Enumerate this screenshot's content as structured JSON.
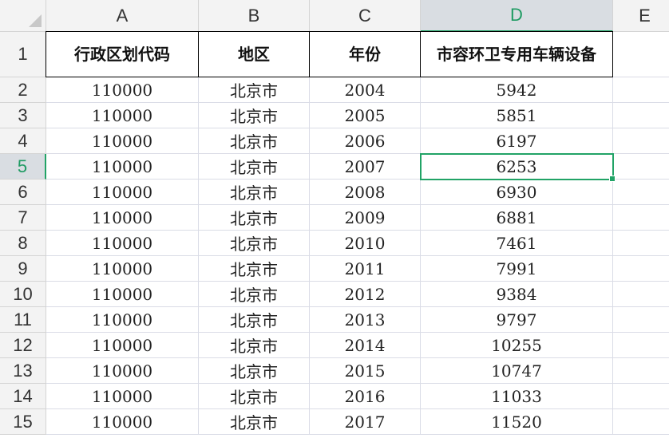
{
  "spreadsheet": {
    "columns": [
      "A",
      "B",
      "C",
      "D",
      "E"
    ],
    "active_column": "D",
    "active_row": "5",
    "header_row": {
      "row_number": "1",
      "cells": [
        "行政区划代码",
        "地区",
        "年份",
        "市容环卫专用车辆设备",
        ""
      ]
    },
    "rows": [
      {
        "row_number": "2",
        "cells": [
          "110000",
          "北京市",
          "2004",
          "5942",
          ""
        ]
      },
      {
        "row_number": "3",
        "cells": [
          "110000",
          "北京市",
          "2005",
          "5851",
          ""
        ]
      },
      {
        "row_number": "4",
        "cells": [
          "110000",
          "北京市",
          "2006",
          "6197",
          ""
        ]
      },
      {
        "row_number": "5",
        "cells": [
          "110000",
          "北京市",
          "2007",
          "6253",
          ""
        ]
      },
      {
        "row_number": "6",
        "cells": [
          "110000",
          "北京市",
          "2008",
          "6930",
          ""
        ]
      },
      {
        "row_number": "7",
        "cells": [
          "110000",
          "北京市",
          "2009",
          "6881",
          ""
        ]
      },
      {
        "row_number": "8",
        "cells": [
          "110000",
          "北京市",
          "2010",
          "7461",
          ""
        ]
      },
      {
        "row_number": "9",
        "cells": [
          "110000",
          "北京市",
          "2011",
          "7991",
          ""
        ]
      },
      {
        "row_number": "10",
        "cells": [
          "110000",
          "北京市",
          "2012",
          "9384",
          ""
        ]
      },
      {
        "row_number": "11",
        "cells": [
          "110000",
          "北京市",
          "2013",
          "9797",
          ""
        ]
      },
      {
        "row_number": "12",
        "cells": [
          "110000",
          "北京市",
          "2014",
          "10255",
          ""
        ]
      },
      {
        "row_number": "13",
        "cells": [
          "110000",
          "北京市",
          "2015",
          "10747",
          ""
        ]
      },
      {
        "row_number": "14",
        "cells": [
          "110000",
          "北京市",
          "2016",
          "11033",
          ""
        ]
      },
      {
        "row_number": "15",
        "cells": [
          "110000",
          "北京市",
          "2017",
          "11520",
          ""
        ]
      }
    ]
  },
  "colors": {
    "accent": "#21a366",
    "header_background": "#f3f3f3",
    "active_header_background": "#d9dde2",
    "gridline": "#dadce6"
  },
  "icons": {
    "corner": "select-all-icon"
  }
}
